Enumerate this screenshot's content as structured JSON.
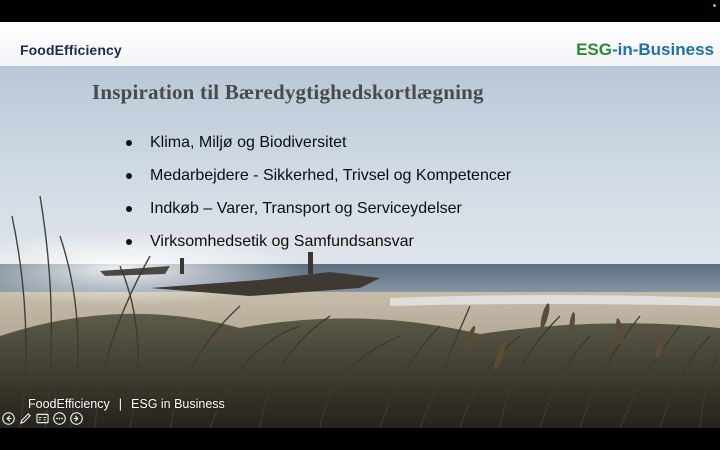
{
  "header": {
    "left_logo": "FoodEfficiency",
    "right_logo_esg": "ESG",
    "right_logo_rest": "-in-Business"
  },
  "slide": {
    "title": "Inspiration til Bæredygtighedskortlægning",
    "bullets": [
      "Klima, Miljø og Biodiversitet",
      "Medarbejdere - Sikkerhed, Trivsel og Kompetencer",
      "Indkøb – Varer, Transport og Serviceydelser",
      "Virksomhedsetik og Samfundsansvar"
    ]
  },
  "footer": {
    "left": "FoodEfficiency",
    "separator": "|",
    "right": "ESG in Business"
  },
  "controls": [
    {
      "icon": "previous-slide-icon"
    },
    {
      "icon": "pen-icon"
    },
    {
      "icon": "subtitles-icon"
    },
    {
      "icon": "more-options-icon"
    },
    {
      "icon": "next-slide-icon"
    }
  ],
  "colors": {
    "logo_left": "#1b2a4e",
    "logo_esg": "#2f8a2f",
    "logo_in_business": "#1d6fae",
    "title": "#4a4a4a",
    "sky": "#c3d2e3",
    "sea": "#6f8294",
    "sand": "#b8a993"
  }
}
